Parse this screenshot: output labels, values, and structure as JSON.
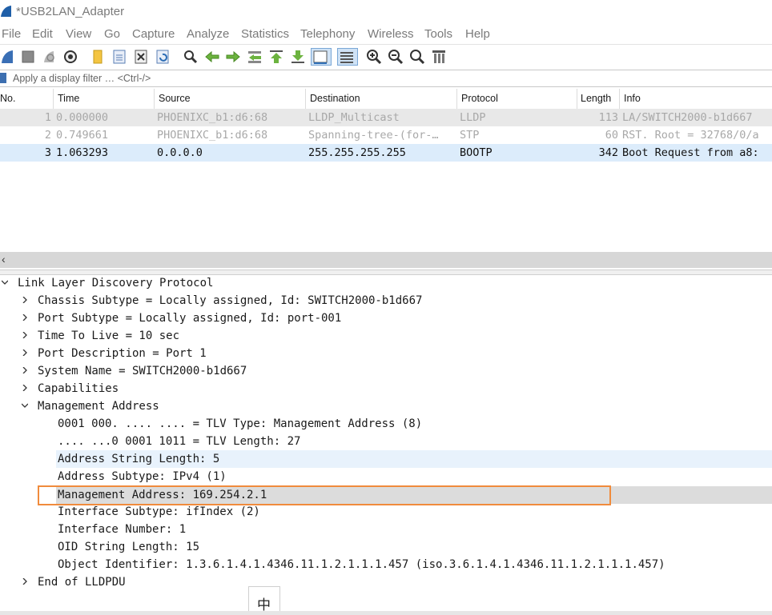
{
  "window": {
    "title": "*USB2LAN_Adapter"
  },
  "menu": [
    "File",
    "Edit",
    "View",
    "Go",
    "Capture",
    "Analyze",
    "Statistics",
    "Telephony",
    "Wireless",
    "Tools",
    "Help"
  ],
  "toolbar": {
    "icons": [
      "shark-fin-start-icon",
      "stop-square-icon",
      "restart-fin-icon",
      "capture-options-gear-icon",
      "open-folder-icon",
      "save-file-icon",
      "close-file-icon",
      "reload-icon",
      "find-magnifier-icon",
      "go-back-arrow-icon",
      "go-forward-arrow-icon",
      "go-to-packet-icon",
      "go-first-icon",
      "go-last-icon",
      "autoscroll-icon",
      "colorize-icon",
      "zoom-in-icon",
      "zoom-out-icon",
      "zoom-reset-icon",
      "resize-columns-icon"
    ]
  },
  "filter": {
    "placeholder": "Apply a display filter … <Ctrl-/>"
  },
  "packet_list": {
    "headers": {
      "no": "No.",
      "time": "Time",
      "source": "Source",
      "destination": "Destination",
      "protocol": "Protocol",
      "length": "Length",
      "info": "Info"
    },
    "rows": [
      {
        "no": "1",
        "time": "0.000000",
        "source": "PHOENIXC_b1:d6:68",
        "destination": "LLDP_Multicast",
        "protocol": "LLDP",
        "length": "113",
        "info": "LA/SWITCH2000-b1d667"
      },
      {
        "no": "2",
        "time": "0.749661",
        "source": "PHOENIXC_b1:d6:68",
        "destination": "Spanning-tree-(for-…",
        "protocol": "STP",
        "length": "60",
        "info": "RST. Root = 32768/0/a"
      },
      {
        "no": "3",
        "time": "1.063293",
        "source": "0.0.0.0",
        "destination": "255.255.255.255",
        "protocol": "BOOTP",
        "length": "342",
        "info": "Boot Request from a8:"
      }
    ]
  },
  "details": {
    "lines": [
      {
        "text": "Link Layer Discovery Protocol",
        "level": 0,
        "toggle": "open"
      },
      {
        "text": "Chassis Subtype = Locally assigned, Id: SWITCH2000-b1d667",
        "level": 1,
        "toggle": "closed"
      },
      {
        "text": "Port Subtype = Locally assigned, Id: port-001",
        "level": 1,
        "toggle": "closed"
      },
      {
        "text": "Time To Live = 10 sec",
        "level": 1,
        "toggle": "closed"
      },
      {
        "text": "Port Description = Port 1",
        "level": 1,
        "toggle": "closed"
      },
      {
        "text": "System Name = SWITCH2000-b1d667",
        "level": 1,
        "toggle": "closed"
      },
      {
        "text": "Capabilities",
        "level": 1,
        "toggle": "closed"
      },
      {
        "text": "Management Address",
        "level": 1,
        "toggle": "open"
      },
      {
        "text": "0001 000. .... .... = TLV Type: Management Address (8)",
        "level": 2,
        "toggle": "none"
      },
      {
        "text": ".... ...0 0001 1011 = TLV Length: 27",
        "level": 2,
        "toggle": "none"
      },
      {
        "text": "Address String Length: 5",
        "level": 2,
        "toggle": "none"
      },
      {
        "text": "Address Subtype: IPv4 (1)",
        "level": 2,
        "toggle": "none"
      },
      {
        "text": "Management Address: 169.254.2.1",
        "level": 2,
        "toggle": "none"
      },
      {
        "text": "Interface Subtype: ifIndex (2)",
        "level": 2,
        "toggle": "none"
      },
      {
        "text": "Interface Number: 1",
        "level": 2,
        "toggle": "none"
      },
      {
        "text": "OID String Length: 15",
        "level": 2,
        "toggle": "none"
      },
      {
        "text": "Object Identifier: 1.3.6.1.4.1.4346.11.1.2.1.1.1.457 (iso.3.6.1.4.1.4346.11.1.2.1.1.1.457)",
        "level": 2,
        "toggle": "none"
      },
      {
        "text": "End of LLDPDU",
        "level": 1,
        "toggle": "closed"
      }
    ]
  },
  "ime": {
    "char": "中"
  },
  "colors": {
    "accent": "#3d6fb0",
    "highlight_box": "#f08b3c",
    "selected_row": "#dcecfb",
    "dim_row": "#e8e8e8"
  }
}
